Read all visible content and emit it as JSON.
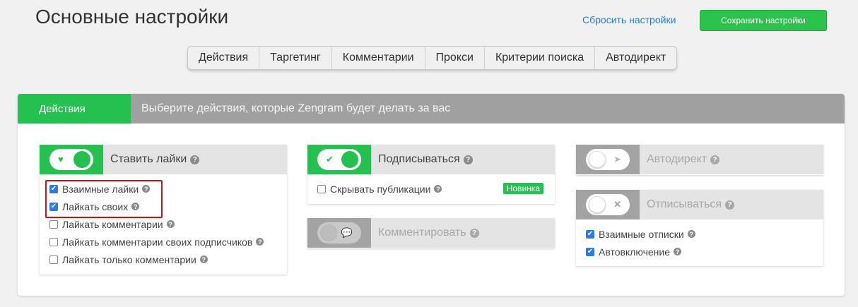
{
  "header": {
    "title": "Основные настройки",
    "reset_label": "Сбросить настройки",
    "save_label": "Сохранить настройки"
  },
  "tabs": [
    {
      "label": "Действия"
    },
    {
      "label": "Таргетинг"
    },
    {
      "label": "Комментарии"
    },
    {
      "label": "Прокси"
    },
    {
      "label": "Критерии поиска"
    },
    {
      "label": "Автодирект"
    }
  ],
  "panel": {
    "label": "Действия",
    "description": "Выберите действия, которые Zengram будет делать за вас"
  },
  "cards": {
    "likes": {
      "title": "Ставить лайки",
      "enabled": true,
      "icon": "heart-icon",
      "options": [
        {
          "label": "Взаимные лайки",
          "checked": true
        },
        {
          "label": "Лайкать своих",
          "checked": true
        },
        {
          "label": "Лайкать комментарии",
          "checked": false
        },
        {
          "label": "Лайкать комментарии своих подписчиков",
          "checked": false
        },
        {
          "label": "Лайкать только комментарии",
          "checked": false
        }
      ]
    },
    "follow": {
      "title": "Подписываться",
      "enabled": true,
      "icon": "check-icon",
      "options": [
        {
          "label": "Скрывать публикации",
          "checked": false
        }
      ],
      "badge": "Новинка"
    },
    "comment": {
      "title": "Комментировать",
      "enabled": false,
      "icon": "speech-bubble-icon"
    },
    "autodirect": {
      "title": "Автодирект",
      "enabled": false,
      "icon": "paper-plane-icon"
    },
    "unfollow": {
      "title": "Отписываться",
      "enabled": false,
      "icon": "cross-icon",
      "options": [
        {
          "label": "Взаимные отписки",
          "checked": true
        },
        {
          "label": "Автовключение",
          "checked": true
        }
      ]
    }
  },
  "colors": {
    "accent_green": "#25c150",
    "checkbox_blue": "#2d7ae0",
    "link_blue": "#2a7fd0",
    "highlight_red": "#c7141b",
    "header_gray": "#a0a0a0"
  }
}
